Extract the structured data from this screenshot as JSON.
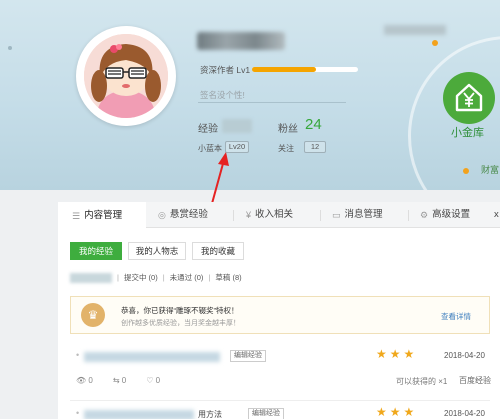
{
  "profile": {
    "level_label": "资深作者 Lv1",
    "level_progress": 0.6,
    "signature_placeholder": "签名没个性!",
    "experience_label": "经验",
    "fans_label": "粉丝",
    "fans_count": "24",
    "rank_label": "小蓝本",
    "rank_value": "Lv20",
    "follow_label": "关注",
    "follow_count": "12"
  },
  "jinku": {
    "label": "小金库",
    "wealth_label": "财富",
    "icon": "yuan-house-icon"
  },
  "tabs": [
    {
      "label": "内容管理",
      "icon": "list-icon",
      "active": true
    },
    {
      "label": "悬赏经验",
      "icon": "target-icon",
      "active": false
    },
    {
      "label": "收入相关",
      "icon": "yen-icon",
      "active": false
    },
    {
      "label": "消息管理",
      "icon": "message-icon",
      "active": false
    },
    {
      "label": "高级设置",
      "icon": "gear-icon",
      "active": false
    },
    {
      "label": "x",
      "icon": "",
      "active": false
    }
  ],
  "subtabs": [
    {
      "label": "我的经验",
      "active": true
    },
    {
      "label": "我的人物志",
      "active": false
    },
    {
      "label": "我的收藏",
      "active": false
    }
  ],
  "filters": {
    "submitted": "提交中 (0)",
    "rejected": "未通过 (0)",
    "drafts": "草稿 (8)",
    "sep": "|"
  },
  "notice": {
    "title": "恭喜，你已获得“雕琢不辍奖”特权！",
    "subtitle": "创作越多优质经验，当月奖金越丰厚！",
    "link": "查看详情"
  },
  "items": [
    {
      "edit_label": "编辑经验",
      "date": "2018-04-20",
      "views": "0",
      "votes": "0",
      "likes": "0",
      "extra": "可以获得的 ×1"
    },
    {
      "title_suffix": "用方法",
      "edit_label": "编辑经验",
      "date": "2018-04-20"
    }
  ],
  "watermark": "百度经验"
}
